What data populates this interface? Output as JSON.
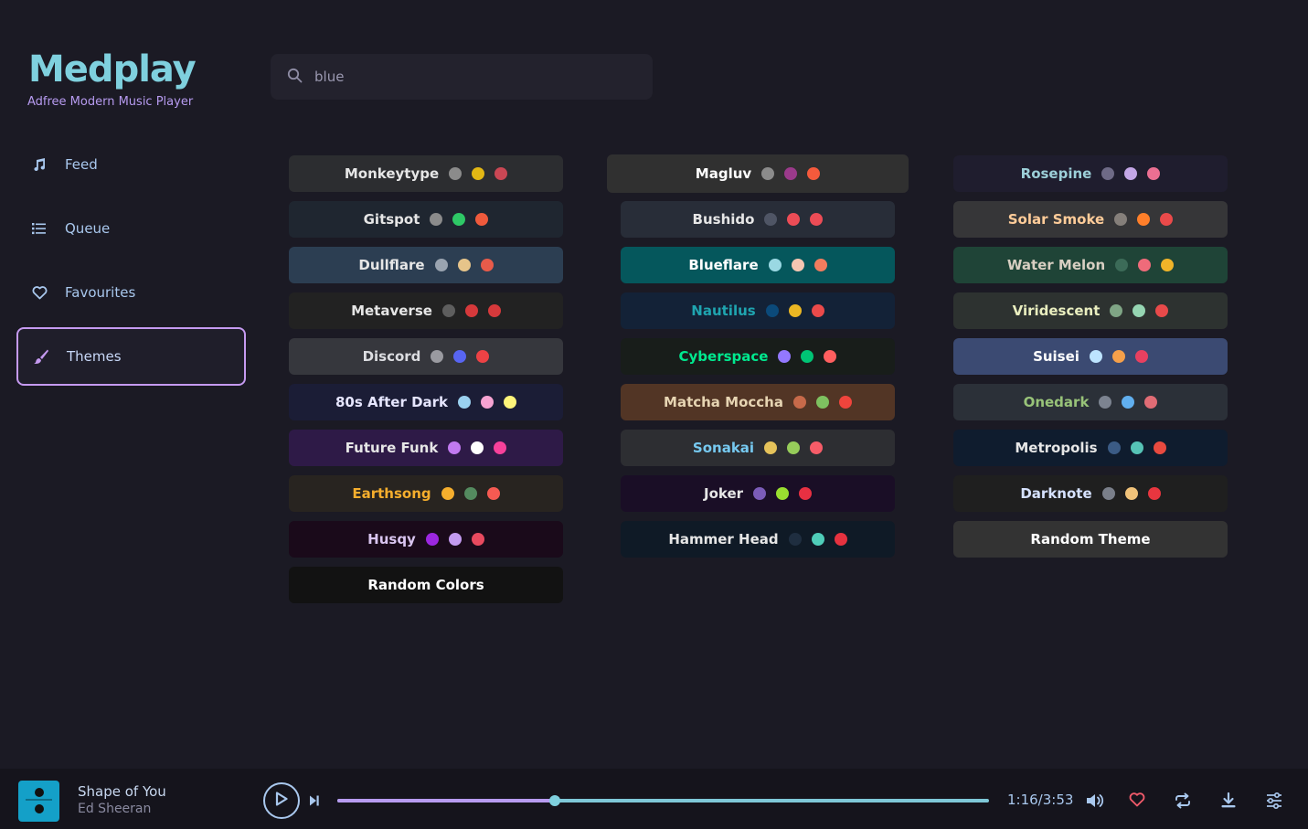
{
  "brand": {
    "logo": "Medplay",
    "tagline": "Adfree Modern Music Player"
  },
  "nav": [
    {
      "label": "Feed",
      "icon": "music-note-icon"
    },
    {
      "label": "Queue",
      "icon": "list-icon"
    },
    {
      "label": "Favourites",
      "icon": "heart-icon"
    },
    {
      "label": "Themes",
      "icon": "brush-icon",
      "active": true
    }
  ],
  "search": {
    "value": "blue",
    "placeholder": ""
  },
  "themes": {
    "col1": [
      {
        "name": "Monkeytype",
        "bg": "#2c2d30",
        "fg": "#e6e6e6",
        "dots": [
          "#8b8b8b",
          "#e2b714",
          "#ca4754"
        ]
      },
      {
        "name": "Gitspot",
        "bg": "#1f2630",
        "fg": "#e6e6e6",
        "dots": [
          "#8b8b8b",
          "#2ec866",
          "#ef5a3c"
        ]
      },
      {
        "name": "Dullflare",
        "bg": "#2c3e52",
        "fg": "#e6e6e6",
        "dots": [
          "#9aa4b0",
          "#e6c48a",
          "#e85b4a"
        ]
      },
      {
        "name": "Metaverse",
        "bg": "#222222",
        "fg": "#e6e6e6",
        "dots": [
          "#5e5e5e",
          "#d6393b",
          "#d6393b"
        ]
      },
      {
        "name": "Discord",
        "bg": "#36373d",
        "fg": "#dcdde1",
        "dots": [
          "#9a9aa0",
          "#5865f2",
          "#ed4245"
        ]
      },
      {
        "name": "80s After Dark",
        "bg": "#1b1d36",
        "fg": "#e6e6ff",
        "dots": [
          "#9ad0ef",
          "#f6a3d2",
          "#fff47a"
        ]
      },
      {
        "name": "Future Funk",
        "bg": "#2e1a47",
        "fg": "#e6e6e6",
        "dots": [
          "#c17af0",
          "#ffffff",
          "#f7419b"
        ]
      },
      {
        "name": "Earthsong",
        "bg": "#282420",
        "fg": "#f5ae2d",
        "dots": [
          "#f5ae2d",
          "#548b5f",
          "#f55a52"
        ]
      },
      {
        "name": "Husqy",
        "bg": "#1a0a1a",
        "fg": "#d9c5f0",
        "dots": [
          "#9c27e0",
          "#c39bf0",
          "#e84a5f"
        ]
      },
      {
        "name": "Random Colors",
        "bg": "#121212",
        "fg": "#ffffff",
        "dots": []
      }
    ],
    "col2": [
      {
        "name": "Magluv",
        "bg": "#303030",
        "fg": "#ffffff",
        "dots": [
          "#8b8b8b",
          "#9b3a8b",
          "#f55a3c"
        ],
        "wide": true
      },
      {
        "name": "Bushido",
        "bg": "#282d38",
        "fg": "#e6e6e6",
        "dots": [
          "#4f5565",
          "#ec4c56",
          "#ec4c56"
        ]
      },
      {
        "name": "Blueflare",
        "bg": "#05575c",
        "fg": "#ffffff",
        "dots": [
          "#9ad8e3",
          "#f5c6b2",
          "#f27c5e"
        ]
      },
      {
        "name": "Nautilus",
        "bg": "#132237",
        "fg": "#1fa5b0",
        "dots": [
          "#0b4a7a",
          "#ebb723",
          "#ea4a4a"
        ]
      },
      {
        "name": "Cyberspace",
        "bg": "#181d1a",
        "fg": "#00e98f",
        "dots": [
          "#9378ff",
          "#00c475",
          "#ff5f5f"
        ]
      },
      {
        "name": "Matcha Moccha",
        "bg": "#523525",
        "fg": "#e6d4b2",
        "dots": [
          "#c76a4a",
          "#7ec160",
          "#f0443c"
        ]
      },
      {
        "name": "Sonakai",
        "bg": "#2d2e32",
        "fg": "#76c9f0",
        "dots": [
          "#e5c25a",
          "#96cc5a",
          "#f65c68"
        ]
      },
      {
        "name": "Joker",
        "bg": "#1a0e26",
        "fg": "#e6e6e6",
        "dots": [
          "#7b5cb8",
          "#99de30",
          "#e83042"
        ]
      },
      {
        "name": "Hammer Head",
        "bg": "#0f1a26",
        "fg": "#e6e6e6",
        "dots": [
          "#1f2e40",
          "#4fcdb9",
          "#e6323f"
        ]
      }
    ],
    "col3": [
      {
        "name": "Rosepine",
        "bg": "#1f1d2e",
        "fg": "#9ccfd8",
        "dots": [
          "#6e6a86",
          "#c4a7e7",
          "#eb6f92"
        ]
      },
      {
        "name": "Solar Smoke",
        "bg": "#363638",
        "fg": "#ffcc99",
        "dots": [
          "#857f7a",
          "#ff7f2a",
          "#ea4a4a"
        ]
      },
      {
        "name": "Water Melon",
        "bg": "#1f4437",
        "fg": "#d8cfc2",
        "dots": [
          "#3c6b58",
          "#ef6b7a",
          "#f0b429"
        ]
      },
      {
        "name": "Viridescent",
        "bg": "#2d3230",
        "fg": "#e9eebf",
        "dots": [
          "#7fa585",
          "#95d5b2",
          "#e84a4a"
        ]
      },
      {
        "name": "Suisei",
        "bg": "#3b4a72",
        "fg": "#ffffff",
        "dots": [
          "#bde4ff",
          "#f5a04a",
          "#e84060"
        ]
      },
      {
        "name": "Onedark",
        "bg": "#2b3038",
        "fg": "#98c379",
        "dots": [
          "#7c8390",
          "#61afef",
          "#e06c75"
        ]
      },
      {
        "name": "Metropolis",
        "bg": "#0f1c2e",
        "fg": "#e6e6e6",
        "dots": [
          "#3b5b85",
          "#56c3b6",
          "#e84a3f"
        ]
      },
      {
        "name": "Darknote",
        "bg": "#1f1f1f",
        "fg": "#d6e2ff",
        "dots": [
          "#7a7f8a",
          "#f0c27a",
          "#e8363f"
        ]
      },
      {
        "name": "Random Theme",
        "bg": "#333333",
        "fg": "#ffffff",
        "dots": []
      }
    ]
  },
  "player": {
    "title": "Shape of You",
    "artist": "Ed Sheeran",
    "time": "1:16/3:53",
    "progress": 0.334
  },
  "colors": {
    "accent": "#b79bf0",
    "brand": "#7fd0de",
    "text": "#a9c8ee"
  }
}
